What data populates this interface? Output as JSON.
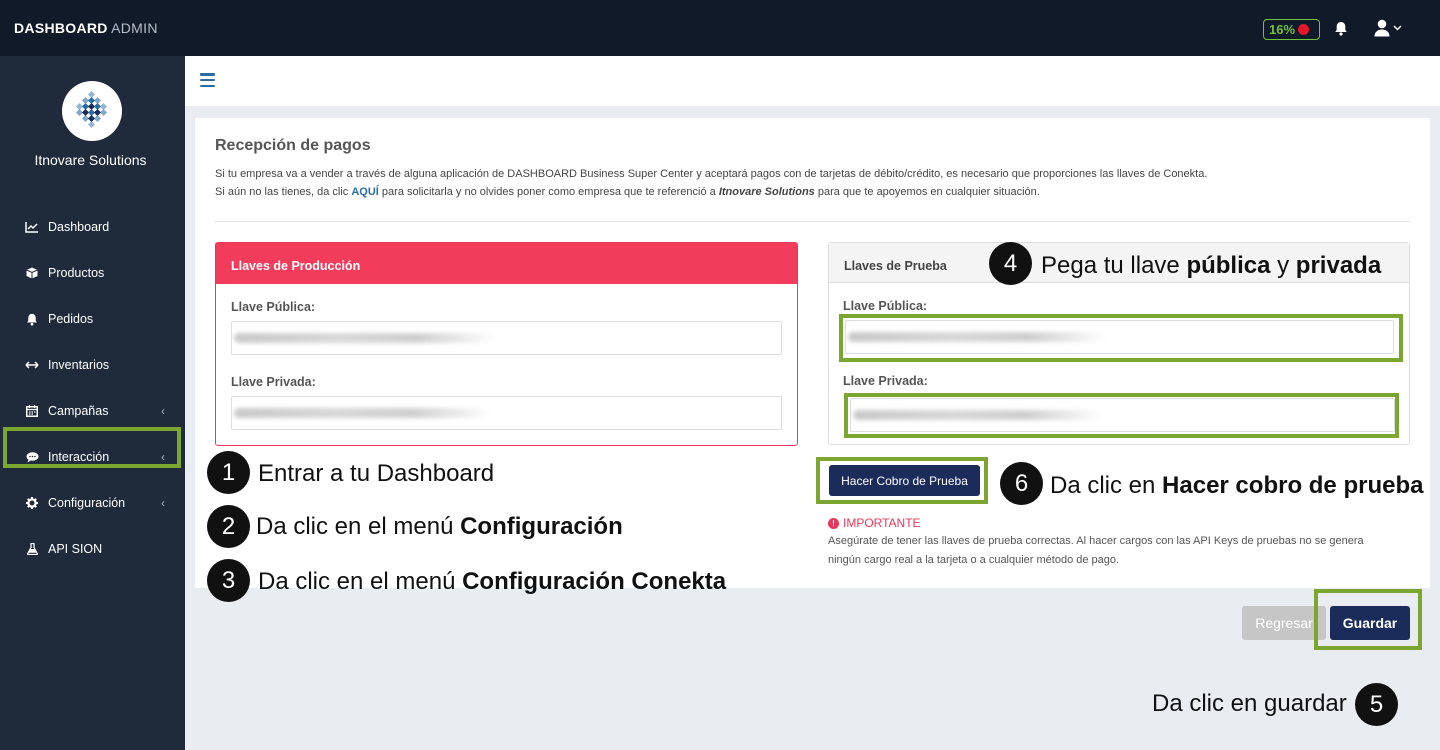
{
  "topbar": {
    "brand_bold": "DASHBOARD",
    "brand_light": "ADMIN",
    "battery_percent": "16%",
    "battery_color": "#6fc23a",
    "record_color": "#e3162a"
  },
  "sidebar": {
    "company": "Itnovare Solutions",
    "items": [
      {
        "label": "Dashboard",
        "icon": "chart-line-icon"
      },
      {
        "label": "Productos",
        "icon": "cube-icon"
      },
      {
        "label": "Pedidos",
        "icon": "bell-icon"
      },
      {
        "label": "Inventarios",
        "icon": "arrows-horizontal-icon"
      },
      {
        "label": "Campañas",
        "icon": "calendar-icon"
      },
      {
        "label": "Interacción",
        "icon": "chat-icon"
      },
      {
        "label": "Configuración",
        "icon": "gear-icon"
      },
      {
        "label": "API SION",
        "icon": "flask-icon"
      }
    ],
    "chevron": "‹"
  },
  "page": {
    "title": "Recepción de pagos",
    "desc_line1": "Si tu empresa va a vender a través de alguna aplicación de DASHBOARD Business Super Center y aceptará pagos con de tarjetas de débito/crédito, es necesario que proporciones las llaves de Conekta.",
    "desc_line2_a": "Si aún no las tienes, da clic ",
    "desc_line2_link": "AQUÍ",
    "desc_line2_b": " para solicitarla y no olvides poner como empresa que te referenció a ",
    "desc_line2_company": "Itnovare Solutions",
    "desc_line2_c": " para que te apoyemos en cualquier situación."
  },
  "production": {
    "title": "Llaves de Producción",
    "public_label": "Llave Pública:",
    "private_label": "Llave Privada:"
  },
  "test": {
    "title": "Llaves de Prueba",
    "public_label": "Llave Pública:",
    "private_label": "Llave Privada:",
    "charge_button": "Hacer Cobro de Prueba",
    "important_label": "IMPORTANTE",
    "important_line1": "Asegúrate de tener las llaves de prueba correctas. Al hacer cargos con las API Keys de pruebas no se genera",
    "important_line2": "ningún cargo real a la tarjeta o a cualquier método de pago."
  },
  "actions": {
    "back": "Regresar",
    "save": "Guardar"
  },
  "annotations": {
    "n1": "1",
    "a1": "Entrar a tu Dashboard",
    "n2": "2",
    "a2_pre": "Da clic en el menú ",
    "a2_bold": "Configuración",
    "n3": "3",
    "a3_pre": "Da clic en el menú ",
    "a3_bold": "Configuración Conekta",
    "n4": "4",
    "a4_pre": "Pega tu llave ",
    "a4_bold1": "pública",
    "a4_mid": " y ",
    "a4_bold2": "privada",
    "n5": "5",
    "a5": "Da clic en guardar",
    "n6": "6",
    "a6_pre": "Da clic en ",
    "a6_bold": "Hacer cobro de prueba"
  },
  "colors": {
    "highlight": "#7ba631",
    "primary_button": "#1b2b5a",
    "danger": "#f23c5b"
  }
}
